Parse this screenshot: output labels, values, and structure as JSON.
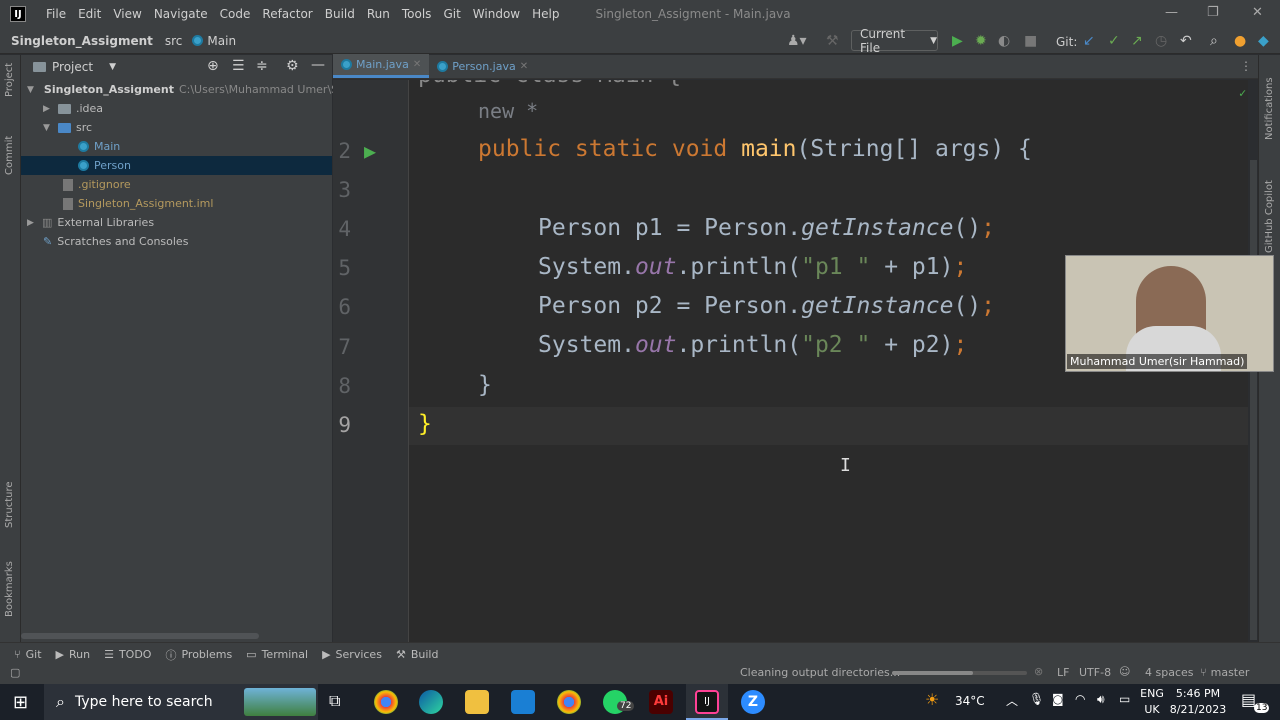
{
  "menu": [
    "File",
    "Edit",
    "View",
    "Navigate",
    "Code",
    "Refactor",
    "Build",
    "Run",
    "Tools",
    "Git",
    "Window",
    "Help"
  ],
  "window_title": "Singleton_Assigment - Main.java",
  "breadcrumbs": {
    "project": "Singleton_Assigment",
    "folder": "src",
    "file": "Main"
  },
  "toolbar": {
    "run_config": "Current File",
    "git_label": "Git:"
  },
  "project_panel": {
    "title": "Project",
    "root": "Singleton_Assigment",
    "root_path": "C:\\Users\\Muhammad Umer\\Sin",
    "items": [
      ".idea",
      "src",
      "Main",
      "Person",
      ".gitignore",
      "Singleton_Assigment.iml",
      "External Libraries",
      "Scratches and Consoles"
    ]
  },
  "left_stripe": {
    "project": "Project",
    "commit": "Commit",
    "structure": "Structure",
    "bookmarks": "Bookmarks"
  },
  "right_stripe": {
    "notifications": "Notifications",
    "copilot": "GitHub Copilot"
  },
  "tabs": [
    "Main.java",
    "Person.java"
  ],
  "editor": {
    "line_numbers": [
      "2",
      "3",
      "4",
      "5",
      "6",
      "7",
      "8",
      "9"
    ],
    "hint_new": "new *",
    "partial_top": "public class Main {"
  },
  "webcam_label": "Muhammad Umer(sir Hammad)",
  "bottom_tabs": [
    "Git",
    "Run",
    "TODO",
    "Problems",
    "Terminal",
    "Services",
    "Build"
  ],
  "status": {
    "message": "Cleaning output directories...",
    "line_sep": "LF",
    "encoding": "UTF-8",
    "indent": "4 spaces",
    "branch": "master"
  },
  "taskbar": {
    "search_placeholder": "Type here to search",
    "whatsapp_badge": "72",
    "temperature": "34°C",
    "language": "ENG",
    "region": "UK",
    "time": "5:46 PM",
    "date": "8/21/2023",
    "notification_count": "13"
  }
}
